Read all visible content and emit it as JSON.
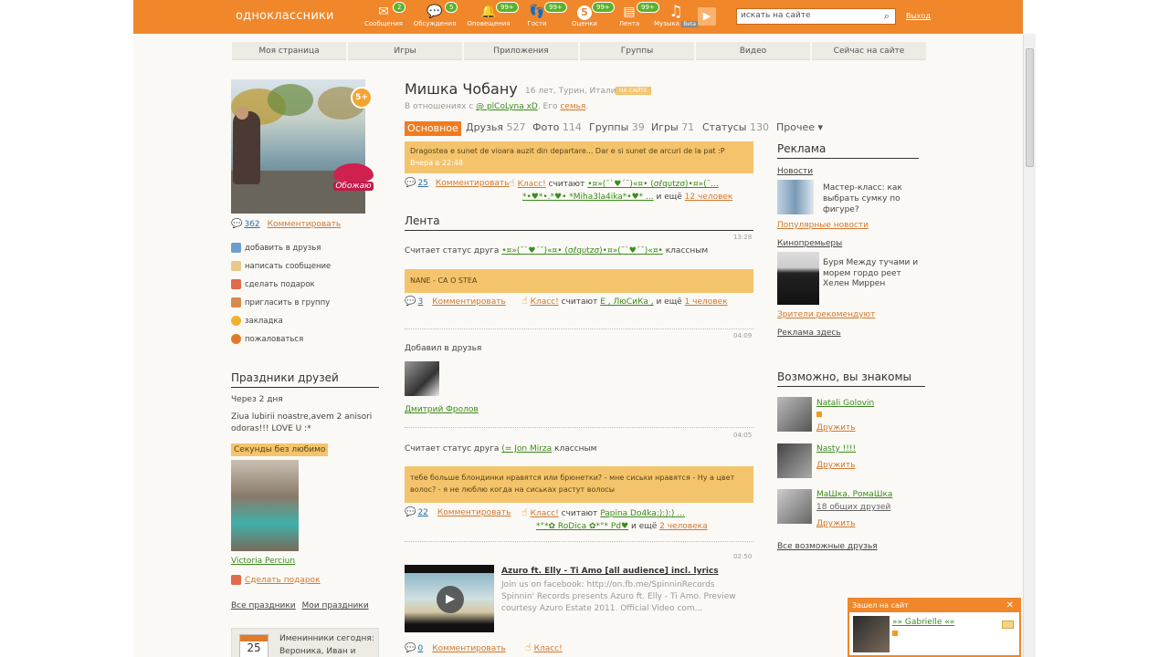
{
  "topbar": {
    "brand": "одноклассники",
    "items": [
      {
        "label": "Сообщения",
        "badge": "2",
        "icon": "envelope-icon",
        "glyph": "✉"
      },
      {
        "label": "Обсуждения",
        "badge": "5",
        "icon": "chat-icon",
        "glyph": "💬"
      },
      {
        "label": "Оповещения",
        "badge": "99+",
        "icon": "bell-icon",
        "glyph": "🔔"
      },
      {
        "label": "Гости",
        "badge": "99+",
        "icon": "footprints-icon",
        "glyph": "👣"
      },
      {
        "label": "Оценки",
        "badge": "99+",
        "icon": "five-icon",
        "glyph": "5"
      },
      {
        "label": "Лента",
        "badge": "99+",
        "icon": "feed-icon",
        "glyph": "▤"
      },
      {
        "label": "Музыка",
        "badge": "Beta",
        "icon": "music-note-icon",
        "glyph": "♫"
      }
    ],
    "search_placeholder": "искать на сайте",
    "logout": "Выход"
  },
  "nav": [
    "Моя страница",
    "Игры",
    "Приложения",
    "Группы",
    "Видео",
    "Сейчас на сайте"
  ],
  "profile": {
    "name": "Мишка Чобану",
    "meta": "16 лет, Турин, Италия",
    "online": "НА САЙТЕ",
    "relation_prefix": "В отношениях с",
    "relation_name": "@ plCoLyna xD",
    "relation_mid": ". Его",
    "relation_link": "семья",
    "photo_badge": "5+",
    "sticker_text": "Обожаю",
    "photo_comments": "362",
    "comment_label": "Комментировать"
  },
  "actions": [
    {
      "label": "добавить в друзья",
      "icon": "add-friend-icon",
      "color": "#6a9fcd"
    },
    {
      "label": "написать сообщение",
      "icon": "envelope-icon",
      "color": "#e9c88a"
    },
    {
      "label": "сделать подарок",
      "icon": "gift-icon",
      "color": "#e06a4a"
    },
    {
      "label": "пригласить в группу",
      "icon": "group-icon",
      "color": "#d88a4a"
    },
    {
      "label": "закладка",
      "icon": "star-icon",
      "color": "#f1b22e"
    },
    {
      "label": "пожаловаться",
      "icon": "report-icon",
      "color": "#e07a2a"
    }
  ],
  "holidays": {
    "title": "Праздники друзей",
    "when": "Через 2 дня",
    "text": "Ziua lubirii noastre,avem 2 anisori odoras!!! LOVE U :*",
    "tag": "Секунды без любимо",
    "person": "Victoria Perciun",
    "gift": "Сделать подарок",
    "all": "Все праздники",
    "mine": "Мои праздники",
    "birthday_label": "Именинники сегодня:",
    "birthday_names": "Вероника, Иван и",
    "date": "25"
  },
  "tabs": [
    {
      "label": "Основное",
      "count": ""
    },
    {
      "label": "Друзья",
      "count": "527"
    },
    {
      "label": "Фото",
      "count": "114"
    },
    {
      "label": "Группы",
      "count": "39"
    },
    {
      "label": "Игры",
      "count": "71"
    },
    {
      "label": "Статусы",
      "count": "130"
    },
    {
      "label": "Прочее ▾",
      "count": ""
    }
  ],
  "status": {
    "text": "Dragostea e sunet de vioara auzit din departare... Dar e si sunet de arcuri de la pat :P",
    "time": "Вчера в 22:48",
    "comments": "25",
    "comment_label": "Комментировать",
    "klass": "Класс!",
    "count_word": "считают",
    "who1": "•¤»(¯`♥´¯)«¤• (σℓqυtzσ)•¤»(¯...",
    "who2": "*•♥*•.*♥• *Miha3la4ika*•♥* ...",
    "and_more": "и ещё",
    "more": "12 человек"
  },
  "feed": {
    "title": "Лента",
    "items": [
      {
        "time": "13:28",
        "intro": "Считает статус друга",
        "friend": "•¤»(¯`♥´¯)«¤• (σℓqυtzσ)•¤»(¯`♥´¯)«¤•",
        "suffix": "классным",
        "box": "NANE - CA O STEA",
        "comments": "3",
        "comment_label": "Комментировать",
        "klass": "Класс!",
        "count_word": "считают",
        "who": "E , ЛюСиКа ,",
        "and_more": "и ещё",
        "more": "1 человек"
      },
      {
        "time": "04:09",
        "intro": "Добавил в друзья",
        "friend": "Дмитрий Фролов"
      },
      {
        "time": "04:05",
        "intro": "Считает статус друга",
        "friend": "(= Jon Mirza",
        "suffix": "классным",
        "box": "тебе больше блондинки нравятся или брюнетки? - мне сиськи нравятся  - Ну а цвет волос? - я не люблю когда на сиськах растут волосы",
        "comments": "22",
        "comment_label": "Комментировать",
        "klass": "Класс!",
        "count_word": "считают",
        "who": "Papina Do4ka:):):) ...",
        "who2": "*°*✿ RoDica ✿*°* Pd♥",
        "and_more": "и ещё",
        "more": "2 человека"
      },
      {
        "time": "02:50",
        "video_title": "Azuro ft. Elly - Ti Amo [all audience] incl. lyrics",
        "video_desc": "Join us on facebook: http://on.fb.me/SpinninRecords Spinnin' Records presents Azuro ft. Elly - Ti Amo. Preview courtesy Azuro Estate 2011. Official Video com...",
        "comments": "0",
        "comment_label": "Комментировать",
        "klass": "Класс!"
      }
    ]
  },
  "ads": {
    "title": "Реклама",
    "news_label": "Новости",
    "news_text": "Мастер-класс: как выбрать сумку по фигуре?",
    "popular": "Популярные новости",
    "cinema_label": "Кинопремьеры",
    "cinema_text": "Буря Между тучами и морем гордо реет Хелен Миррен",
    "recommend": "Зрители рекомендуют",
    "here": "Реклама здесь"
  },
  "maybe": {
    "title": "Возможно, вы знакомы",
    "people": [
      {
        "name": "Natali Golovin",
        "extra": "",
        "action": "Дружить"
      },
      {
        "name": "Nasty !!!!",
        "extra": "",
        "action": "Дружить"
      },
      {
        "name": "МаШка. РомаШка",
        "extra": "18 общих друзей",
        "action": "Дружить"
      }
    ],
    "all": "Все возможные друзья"
  },
  "popup": {
    "title": "Зашел на сайт",
    "name": "»» Gabrielle ««"
  }
}
